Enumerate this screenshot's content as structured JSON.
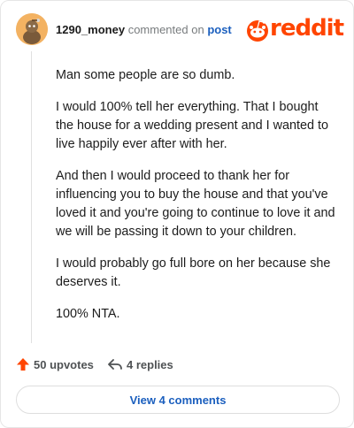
{
  "header": {
    "username": "1290_money",
    "action": "commented on",
    "post_link": "post",
    "logo_text": "reddit",
    "avatar_icon": "snoo-avatar-icon",
    "brand_color": "#ff4500"
  },
  "comment": {
    "paragraphs": [
      "Man some people are so dumb.",
      "I would 100% tell her everything. That I bought the house for a wedding present and I wanted to live happily ever after with her.",
      "And then I would proceed to thank her for influencing you to buy the house and that you've loved it and you're going to continue to love it and we will be passing it down to your children.",
      "I would probably go full bore on her because she deserves it.",
      "100% NTA."
    ]
  },
  "footer": {
    "upvotes_label": "50 upvotes",
    "replies_label": "4 replies",
    "upvote_icon": "upvote-arrow-icon",
    "reply_icon": "reply-arrow-icon"
  },
  "view_comments_label": "View 4 comments",
  "link_color": "#1b5fbe"
}
